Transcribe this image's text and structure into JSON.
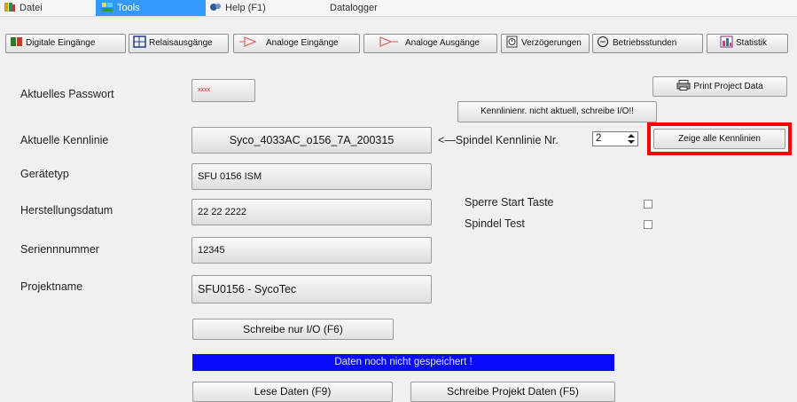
{
  "menu": {
    "datei": "Datei",
    "tools": "Tools",
    "help": "Help (F1)",
    "datalogger": "Datalogger"
  },
  "toolbar": {
    "digitale": "Digitale Eingänge",
    "relais": "Relaisausgänge",
    "analog_in": "Analoge Eingänge",
    "analog_out": "Analoge Ausgänge",
    "verz": "Verzögerungen",
    "betrieb": "Betriebsstunden",
    "statistik": "Statistik"
  },
  "form": {
    "passwort_label": "Aktuelles Passwort",
    "passwort_value": "xxxx",
    "print_button": "Print Project Data",
    "kennlinie_warn_button": "Kennlinienr. nicht aktuell, schreibe I/O!!",
    "kennlinie_label": "Aktuelle Kennlinie",
    "kennlinie_value": "Syco_4033AC_o156_7A_200315",
    "spindel_kennlinie_label": "<—Spindel Kennlinie Nr.",
    "spindel_kennlinie_nr": "2",
    "zeige_button": "Zeige alle Kennlinien",
    "geraetetyp_label": "Gerätetyp",
    "geraetetyp_value": "SFU 0156  ISM",
    "herstellung_label": "Herstellungsdatum",
    "herstellung_value": "22 22 2222",
    "sperre_label": "Sperre Start Taste",
    "spindel_test_label": "Spindel Test",
    "serien_label": "Seriennnummer",
    "serien_value": "12345",
    "projekt_label": "Projektname",
    "projekt_value": "SFU0156 - SycoTec",
    "schreibe_io_button": "Schreibe nur I/O (F6)",
    "status_text": "Daten noch nicht gespeichert !",
    "lese_button": "Lese Daten (F9)",
    "schreibe_projekt_button": "Schreibe Projekt Daten (F5)"
  },
  "colors": {
    "highlight_box": "#ff0000",
    "status_bar": "#0a0aff",
    "menu_active": "#3399ff",
    "password_text": "#e02020"
  }
}
